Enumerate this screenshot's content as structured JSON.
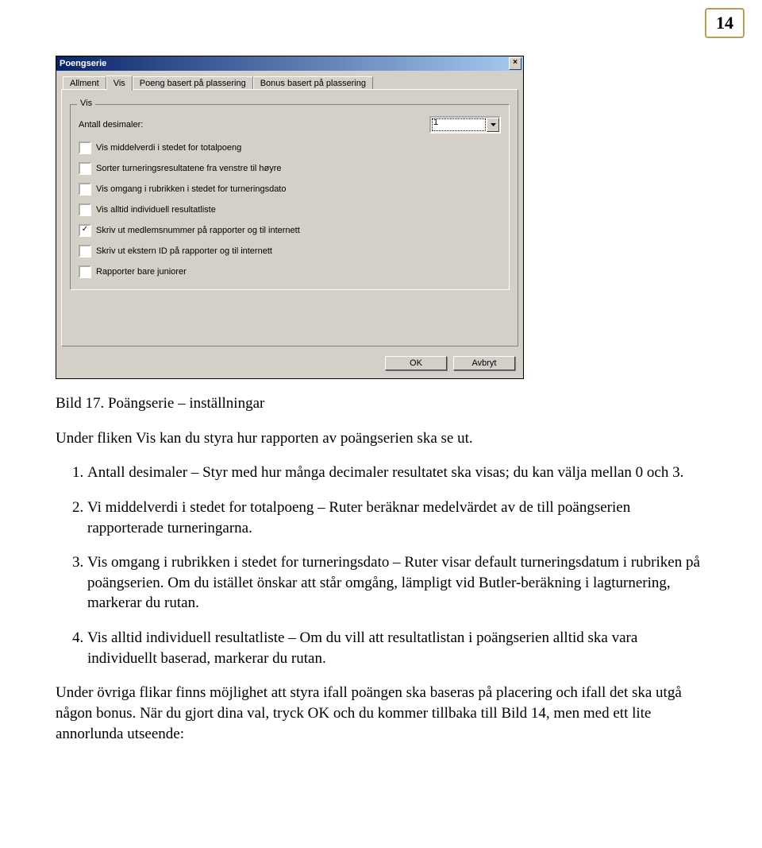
{
  "page_number": "14",
  "window": {
    "title": "Poengserie",
    "close_symbol": "×",
    "tabs": {
      "t0": "Allment",
      "t1": "Vis",
      "t2": "Poeng basert på plassering",
      "t3": "Bonus basert på plassering"
    },
    "groupbox_title": "Vis",
    "decimals_label": "Antall desimaler:",
    "decimals_value": "1",
    "checks": {
      "c0": "Vis middelverdi i stedet for totalpoeng",
      "c1": "Sorter turneringsresultatene fra venstre til høyre",
      "c2": "Vis omgang i rubrikken i stedet for turneringsdato",
      "c3": "Vis alltid individuell resultatliste",
      "c4": "Skriv ut medlemsnummer på rapporter og til internett",
      "c5": "Skriv ut ekstern ID på rapporter og til internett",
      "c6": "Rapporter bare juniorer"
    },
    "buttons": {
      "ok": "OK",
      "cancel": "Avbryt"
    }
  },
  "doc": {
    "caption": "Bild 17. Poängserie – inställningar",
    "intro": "Under fliken Vis kan du styra hur rapporten av poängserien ska se ut.",
    "item1_term": "Antall desimaler",
    "item1_rest": " – Styr med hur många decimaler resultatet ska visas; du kan välja mellan 0 och 3.",
    "item2_term": "Vi middelverdi i stedet for totalpoeng",
    "item2_rest": " – Ruter beräknar medelvärdet av de till poängserien rapporterade turneringarna.",
    "item3_term": "Vis omgang i rubrikken i stedet for turneringsdato",
    "item3_rest": " – Ruter visar default turneringsdatum i rubriken på poängserien. Om du istället önskar att står omgång, lämpligt vid Butler-beräkning i lagturnering, markerar du rutan.",
    "item4_term": "Vis alltid individuell resultatliste",
    "item4_rest": " – Om du vill att resultatlistan i poängserien alltid ska vara individuellt baserad, markerar du rutan.",
    "closing": "Under övriga flikar finns möjlighet att styra ifall poängen ska baseras på placering och ifall det ska utgå någon bonus. När du gjort dina val, tryck OK och du kommer tillbaka till Bild 14, men med ett lite annorlunda utseende:"
  }
}
